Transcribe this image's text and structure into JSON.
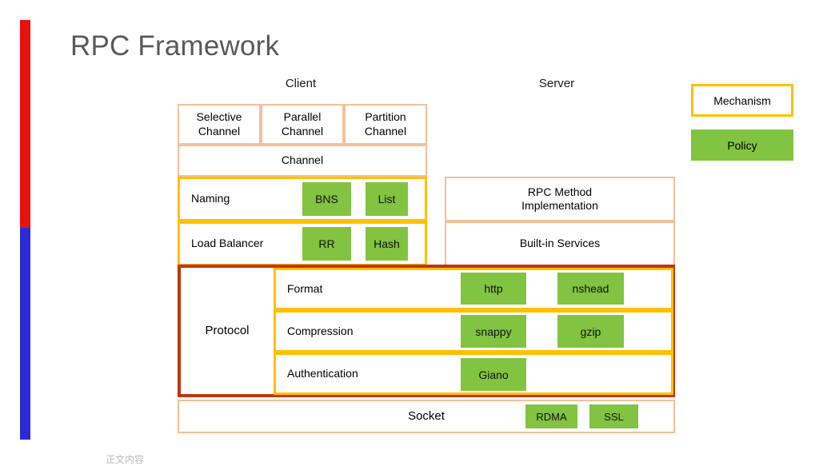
{
  "slide": {
    "title": "RPC Framework",
    "footer_note": "正文内容"
  },
  "accent_bar": {
    "top_color": "#E8120C",
    "bottom_color": "#2B2BD6"
  },
  "colors": {
    "peach_border": "#F4C09A",
    "gold_border": "#FFC000",
    "red_border": "#C0360F",
    "policy_green": "#82C341",
    "title_gray": "#595959"
  },
  "columns": {
    "client_heading": "Client",
    "server_heading": "Server"
  },
  "legend": {
    "mechanism_label": "Mechanism",
    "policy_label": "Policy"
  },
  "client": {
    "channels": [
      {
        "label": "Selective\nChannel"
      },
      {
        "label": "Parallel\nChannel"
      },
      {
        "label": "Partition\nChannel"
      }
    ],
    "channel_row_label": "Channel",
    "naming": {
      "label": "Naming",
      "chips": [
        "BNS",
        "List"
      ]
    },
    "load_balancer": {
      "label": "Load Balancer",
      "chips": [
        "RR",
        "Hash"
      ]
    }
  },
  "server": {
    "rows": [
      {
        "label": "RPC Method\nImplementation"
      },
      {
        "label": "Built-in Services"
      }
    ]
  },
  "protocol": {
    "label": "Protocol",
    "rows": [
      {
        "label": "Format",
        "chips": [
          "http",
          "nshead"
        ]
      },
      {
        "label": "Compression",
        "chips": [
          "snappy",
          "gzip"
        ]
      },
      {
        "label": "Authentication",
        "chips": [
          "Giano"
        ]
      }
    ]
  },
  "socket": {
    "label": "Socket",
    "chips": [
      "RDMA",
      "SSL"
    ]
  }
}
